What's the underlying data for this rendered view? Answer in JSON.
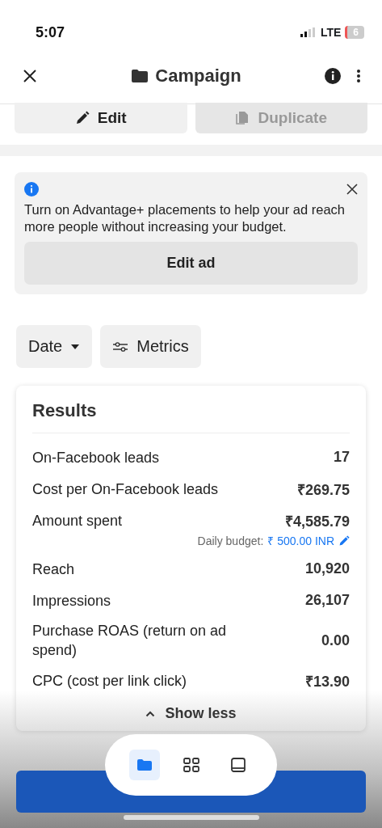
{
  "status_bar": {
    "time": "5:07",
    "network": "LTE",
    "battery": "6"
  },
  "header": {
    "title": "Campaign"
  },
  "actions": [
    {
      "label": "Edit",
      "kind": "edit",
      "disabled": false
    },
    {
      "label": "Duplicate",
      "kind": "duplicate",
      "disabled": true
    }
  ],
  "banner": {
    "text": "Turn on Advantage+ placements to help your ad reach more people without increasing your budget.",
    "button": "Edit ad"
  },
  "filters": [
    {
      "label": "Date",
      "kind": "dropdown"
    },
    {
      "label": "Metrics",
      "kind": "sliders"
    }
  ],
  "results": {
    "title": "Results",
    "rows": [
      {
        "label": "On-Facebook leads",
        "value": "17"
      },
      {
        "label": "Cost per On-Facebook leads",
        "value": "₹269.75"
      },
      {
        "label": "Amount spent",
        "value": "₹4,585.79",
        "sub_label": "Daily budget:",
        "sub_link": "₹ 500.00 INR"
      },
      {
        "label": "Reach",
        "value": "10,920"
      },
      {
        "label": "Impressions",
        "value": "26,107"
      },
      {
        "label": "Purchase ROAS (return on ad spend)",
        "value": "0.00"
      },
      {
        "label": "CPC (cost per link click)",
        "value": "₹13.90"
      }
    ],
    "toggle": "Show less"
  },
  "bottom_nav": [
    {
      "kind": "folder",
      "selected": true
    },
    {
      "kind": "grid",
      "selected": false
    },
    {
      "kind": "tablet",
      "selected": false
    }
  ]
}
